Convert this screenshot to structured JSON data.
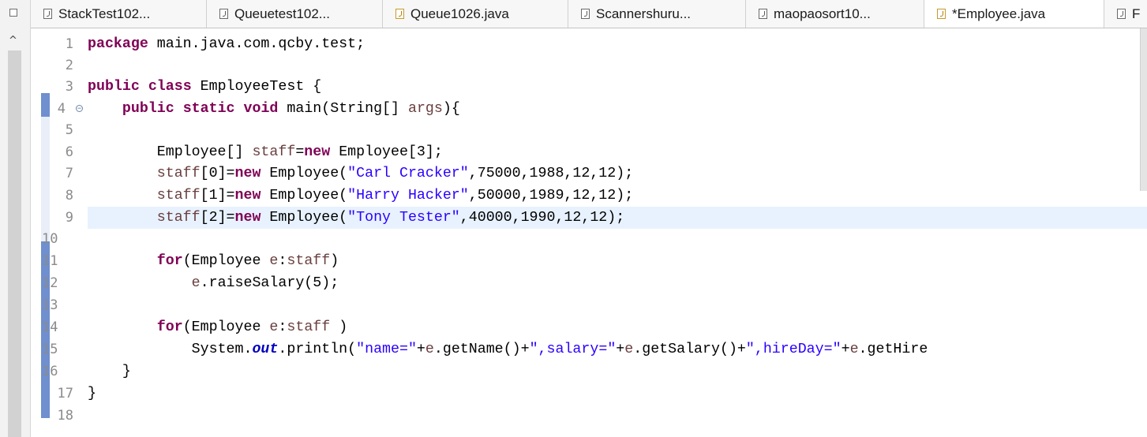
{
  "tabs": [
    {
      "label": "StackTest102...",
      "icon": "java-file-icon"
    },
    {
      "label": "Queuetest102...",
      "icon": "java-file-icon"
    },
    {
      "label": "Queue1026.java",
      "icon": "java-file-icon"
    },
    {
      "label": "Scannershuru...",
      "icon": "java-file-icon"
    },
    {
      "label": "maopaosort10...",
      "icon": "java-file-icon"
    },
    {
      "label": "*Employee.java",
      "icon": "java-file-icon"
    },
    {
      "label": "F",
      "icon": "java-file-icon"
    }
  ],
  "editor": {
    "current_line": 9,
    "line_numbers": [
      "1",
      "2",
      "3",
      "4",
      "5",
      "6",
      "7",
      "8",
      "9",
      "10",
      "11",
      "12",
      "13",
      "14",
      "15",
      "16",
      "17",
      "18"
    ],
    "lines": {
      "l1": {
        "kw1": "package",
        "t1": " main.java.com.qcby.test;"
      },
      "l3": {
        "kw1": "public",
        "t1": " ",
        "kw2": "class",
        "t2": " EmployeeTest {"
      },
      "l4": {
        "kw1": "public",
        "t1": " ",
        "kw2": "static",
        "t2": " ",
        "kw3": "void",
        "t3": " main(String[] ",
        "v1": "args",
        "t4": "){"
      },
      "l6": {
        "t1": "Employee[] ",
        "v1": "staff",
        "t2": "=",
        "kw1": "new",
        "t3": " Employee[3];"
      },
      "l7": {
        "v1": "staff",
        "t1": "[0]=",
        "kw1": "new",
        "t2": " Employee(",
        "s1": "\"Carl Cracker\"",
        "t3": ",75000,1988,12,12);"
      },
      "l8": {
        "v1": "staff",
        "t1": "[1]=",
        "kw1": "new",
        "t2": " Employee(",
        "s1": "\"Harry Hacker\"",
        "t3": ",50000,1989,12,12);"
      },
      "l9": {
        "v1": "staff",
        "t1": "[2]=",
        "kw1": "new",
        "t2": " Employee(",
        "s1": "\"Tony Tester\"",
        "t3": ",40000,1990,12,12);"
      },
      "l11": {
        "kw1": "for",
        "t1": "(Employee ",
        "v1": "e",
        "t2": ":",
        "v2": "staff",
        "t3": ")"
      },
      "l12": {
        "v1": "e",
        "t1": ".raiseSalary(5);"
      },
      "l14": {
        "kw1": "for",
        "t1": "(Employee ",
        "v1": "e",
        "t2": ":",
        "v2": "staff",
        "t3": " )"
      },
      "l15": {
        "t1": "System.",
        "f1": "out",
        "t2": ".println(",
        "s1": "\"name=\"",
        "t3": "+",
        "v1": "e",
        "t4": ".getName()+",
        "s2": "\",salary=\"",
        "t5": "+",
        "v2": "e",
        "t6": ".getSalary()+",
        "s3": "\",hireDay=\"",
        "t7": "+",
        "v3": "e",
        "t8": ".getHire"
      },
      "l16": {
        "t1": "}"
      },
      "l17": {
        "t1": "}"
      }
    }
  },
  "colors": {
    "keyword": "#7f0055",
    "string": "#2a00ff",
    "field": "#0000c0",
    "variable": "#6a3e3e",
    "current_line": "#e8f2fe"
  }
}
